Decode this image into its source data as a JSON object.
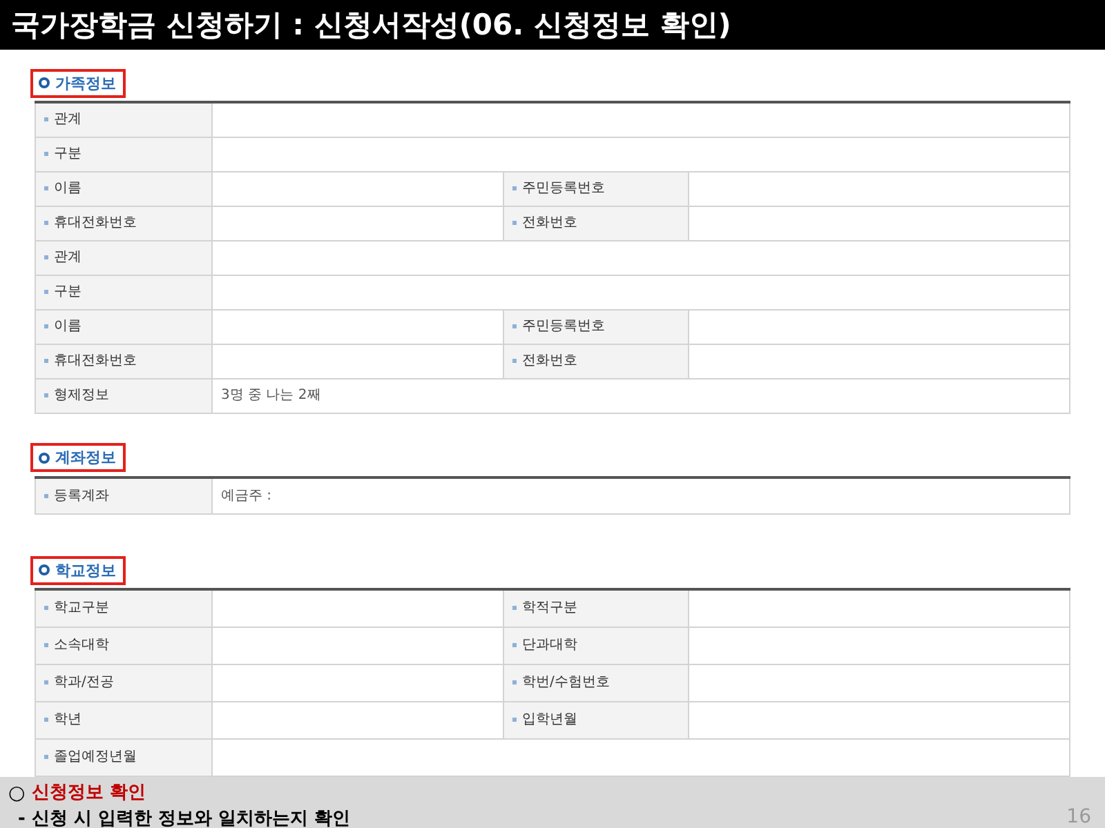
{
  "title": "국가장학금 신청하기 : 신청서작성(06. 신청정보 확인)",
  "sections": [
    {
      "heading": "가족정보",
      "highlighted": true,
      "rows": [
        [
          {
            "label": "관계"
          }
        ],
        [
          {
            "label": "구분"
          }
        ],
        [
          {
            "label": "이름"
          },
          {
            "label": "주민등록번호"
          }
        ],
        [
          {
            "label": "휴대전화번호"
          },
          {
            "label": "전화번호"
          }
        ],
        [
          {
            "label": "관계"
          }
        ],
        [
          {
            "label": "구분"
          }
        ],
        [
          {
            "label": "이름"
          },
          {
            "label": "주민등록번호"
          }
        ],
        [
          {
            "label": "휴대전화번호"
          },
          {
            "label": "전화번호"
          }
        ],
        [
          {
            "label": "형제정보",
            "value": "3명 중 나는 2째"
          }
        ]
      ]
    },
    {
      "heading": "계좌정보",
      "highlighted": true,
      "rows": [
        [
          {
            "label": "등록계좌",
            "value": "예금주 :"
          }
        ]
      ]
    },
    {
      "heading": "학교정보",
      "highlighted": true,
      "rows": [
        [
          {
            "label": "학교구분"
          },
          {
            "label": "학적구분"
          }
        ],
        [
          {
            "label": "소속대학"
          },
          {
            "label": "단과대학"
          }
        ],
        [
          {
            "label": "학과/전공"
          },
          {
            "label": "학번/수험번호"
          }
        ],
        [
          {
            "label": "학년"
          },
          {
            "label": "입학년월"
          }
        ],
        [
          {
            "label": "졸업예정년월"
          }
        ]
      ]
    }
  ],
  "footer": {
    "bullet": "○",
    "heading": "신청정보 확인",
    "detail": "- 신청 시 입력한 정보와 일치하는지 확인",
    "page_number": "16"
  }
}
